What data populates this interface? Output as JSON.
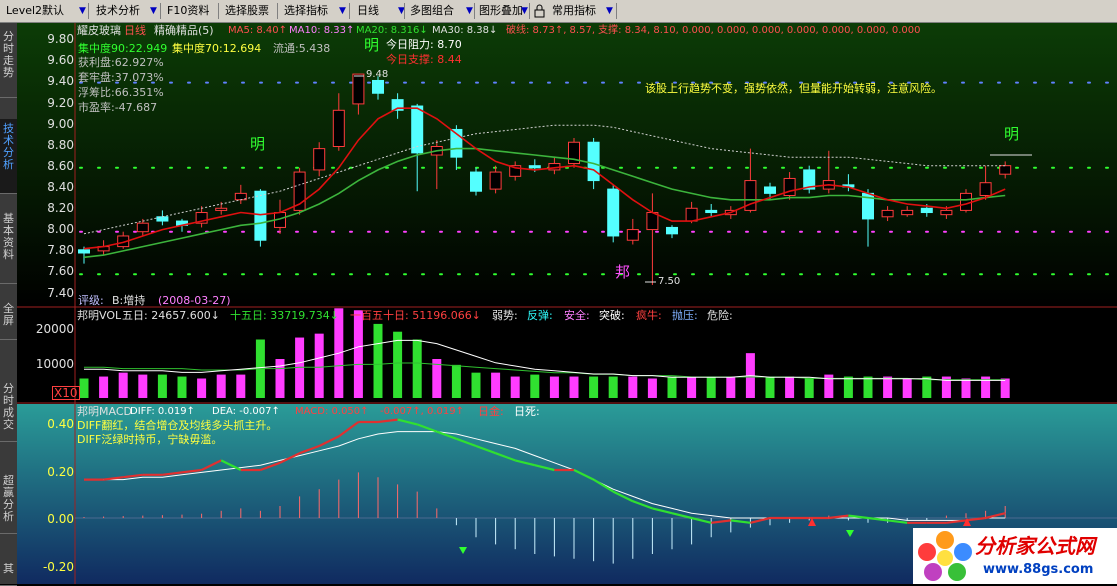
{
  "toolbar": {
    "items": [
      "Level2默认",
      "技术分析",
      "F10资料",
      "选择股票",
      "选择指标",
      "日线",
      "多图组合",
      "图形叠加",
      "常用指标"
    ]
  },
  "sidebar": {
    "tabs": [
      "分时走势",
      "技术分析",
      "基本资料",
      "全屏",
      "分时成交",
      "超赢分析",
      "其"
    ]
  },
  "main": {
    "stock_name": "耀皮玻璃",
    "period": "日线",
    "indicator": "精确精品(5)",
    "ma": {
      "ma5": "MA5: 8.40↑",
      "ma10": "MA10: 8.33↑",
      "ma20": "MA20: 8.316↓",
      "ma30": "MA30: 8.38↓",
      "break_line": "破线: 8.73↑, 8.57, 支撑: 8.34, 8.10, 0.000, 0.000, 0.000, 0.000, 0.000, 0.000, 0.000"
    },
    "stats": [
      "集中度90:22.949",
      "集中度70:12.694",
      "流通:5.438"
    ],
    "chip_stats": [
      "获利盘:62.927%",
      "套牢盘:37.073%",
      "浮筹比:66.351%",
      "市盈率:-47.687"
    ],
    "resistance": "今日阻力: 8.70",
    "support": "今日支撑: 8.44",
    "comment": "该股上行趋势不变，强势依然，但量能开始转弱，注意风险。",
    "high_label": "9.48",
    "low_label": "7.50",
    "ming": "明",
    "bang": "邦",
    "rating_label": "评级:",
    "rating_value": "B:增持",
    "rating_date": "(2008-03-27)",
    "yaxis": [
      "9.80",
      "9.60",
      "9.40",
      "9.20",
      "9.00",
      "8.80",
      "8.60",
      "8.40",
      "8.20",
      "8.00",
      "7.80",
      "7.60",
      "7.40"
    ]
  },
  "volume": {
    "title": "邦明VOL",
    "d5": "五日: 24657.600↓",
    "d15": "十五日: 33719.734↓",
    "d150": "一百五十日: 51196.066↓",
    "signals": [
      "弱势:",
      "反弹:",
      "安全:",
      "突破:",
      "疯牛:",
      "抛压:",
      "危险:"
    ],
    "yaxis": [
      "20000",
      "10000"
    ],
    "unit": "X10"
  },
  "macd": {
    "title": "邦明MACD",
    "diff": "DIFF: 0.019↑",
    "dea": "DEA: -0.007↑",
    "macd": "MACD: 0.050↑",
    "extra": "-0.007↑, 0.019↑",
    "golden": "日金:",
    "death": "日死:",
    "note1": "DIFF翻红，结合增仓及均线多头抓主升。",
    "note2": "DIFF泛绿时持币，宁缺毋滥。",
    "yaxis": [
      "0.40",
      "0.20",
      "0.00",
      "-0.20"
    ]
  },
  "watermark": {
    "title": "分析家公式网",
    "url": "www.88gs.com"
  },
  "colors": {
    "up": "#ff3c3c",
    "down": "#54ffff",
    "ma_red": "#e01010",
    "ma_green": "#3cb43c",
    "vol_up": "#ff3cff",
    "vol_down": "#30e030",
    "macd_red": "#e03030",
    "macd_green": "#30e030"
  }
}
